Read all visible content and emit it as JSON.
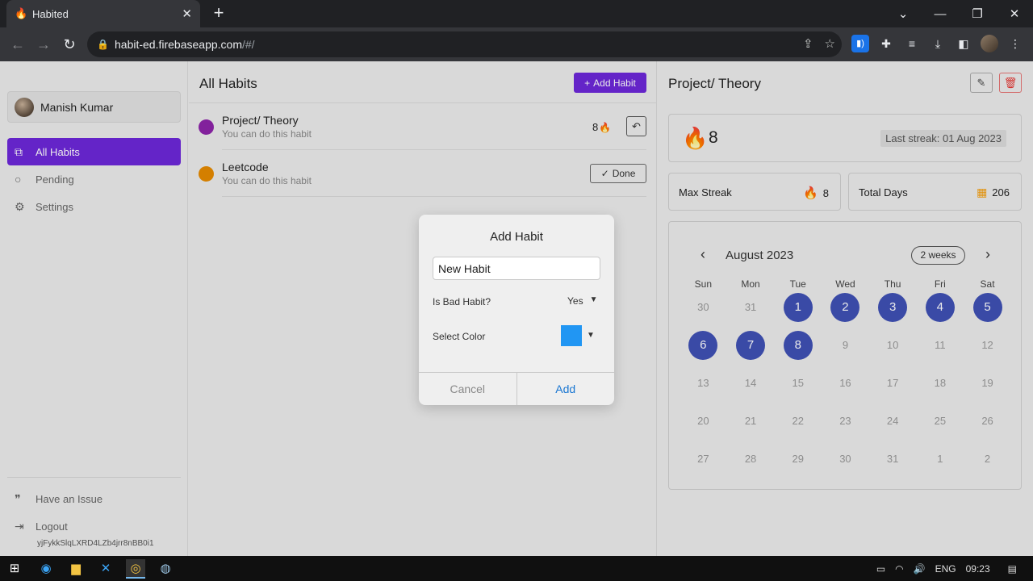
{
  "browser": {
    "tab_title": "Habited",
    "url_host": "habit-ed.firebaseapp.com",
    "url_path": "/#/"
  },
  "sidebar": {
    "user_name": "Manish Kumar",
    "items": [
      {
        "label": "All Habits",
        "icon": "stack-icon",
        "active": true
      },
      {
        "label": "Pending",
        "icon": "circle-icon",
        "active": false
      },
      {
        "label": "Settings",
        "icon": "gear-icon",
        "active": false
      }
    ],
    "footer": [
      {
        "label": "Have an Issue",
        "icon": "quote-icon"
      },
      {
        "label": "Logout",
        "icon": "logout-icon"
      }
    ],
    "uid": "yjFykkSlqLXRD4LZb4jrr8nBB0i1"
  },
  "main": {
    "title": "All Habits",
    "add_label": "Add Habit",
    "habits": [
      {
        "name": "Project/ Theory",
        "sub": "You can do this habit",
        "color": "#8e24aa",
        "streak": "8",
        "action": "undo"
      },
      {
        "name": "Leetcode",
        "sub": "You can do this habit",
        "color": "#e68a00",
        "action_label": "Done"
      }
    ]
  },
  "detail": {
    "title": "Project/ Theory",
    "streak": "8",
    "last_streak": "Last streak: 01 Aug 2023",
    "max_streak_label": "Max Streak",
    "max_streak_value": "8",
    "total_days_label": "Total Days",
    "total_days_value": "206",
    "calendar": {
      "month": "August 2023",
      "range_label": "2 weeks",
      "dow": [
        "Sun",
        "Mon",
        "Tue",
        "Wed",
        "Thu",
        "Fri",
        "Sat"
      ],
      "weeks": [
        [
          "30",
          "31",
          "1",
          "2",
          "3",
          "4",
          "5"
        ],
        [
          "6",
          "7",
          "8",
          "9",
          "10",
          "11",
          "12"
        ],
        [
          "13",
          "14",
          "15",
          "16",
          "17",
          "18",
          "19"
        ],
        [
          "20",
          "21",
          "22",
          "23",
          "24",
          "25",
          "26"
        ],
        [
          "27",
          "28",
          "29",
          "30",
          "31",
          "1",
          "2"
        ]
      ],
      "completed": [
        "1",
        "2",
        "3",
        "4",
        "5",
        "6",
        "7",
        "8"
      ]
    }
  },
  "modal": {
    "title": "Add Habit",
    "name_value": "New Habit",
    "bad_habit_label": "Is Bad Habit?",
    "bad_habit_value": "Yes",
    "color_label": "Select Color",
    "color_value": "#2196f3",
    "cancel_label": "Cancel",
    "add_label": "Add"
  },
  "taskbar": {
    "lang": "ENG",
    "time": "09:23"
  }
}
